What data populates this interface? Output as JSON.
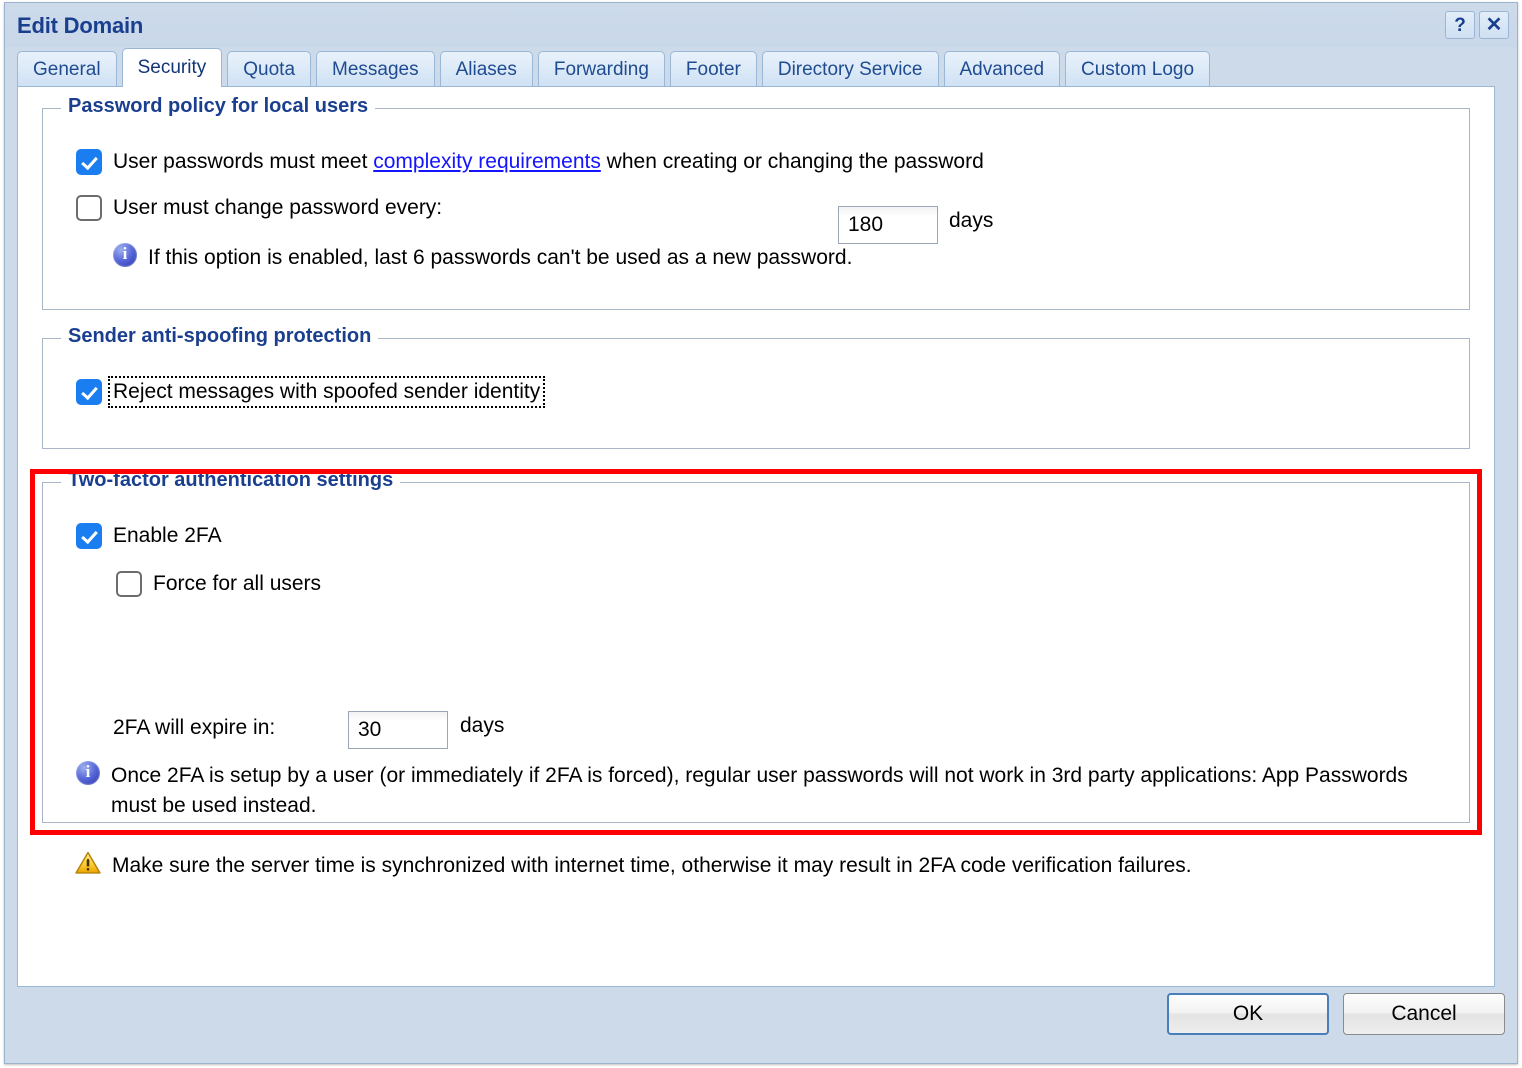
{
  "window": {
    "title": "Edit Domain",
    "help_icon": "?",
    "close_icon": "✕"
  },
  "tabs": [
    {
      "label": "General",
      "active": false
    },
    {
      "label": "Security",
      "active": true
    },
    {
      "label": "Quota",
      "active": false
    },
    {
      "label": "Messages",
      "active": false
    },
    {
      "label": "Aliases",
      "active": false
    },
    {
      "label": "Forwarding",
      "active": false
    },
    {
      "label": "Footer",
      "active": false
    },
    {
      "label": "Directory Service",
      "active": false
    },
    {
      "label": "Advanced",
      "active": false
    },
    {
      "label": "Custom Logo",
      "active": false
    }
  ],
  "password_policy": {
    "legend": "Password policy for local users",
    "complexity_pre": "User passwords must meet ",
    "complexity_link": "complexity requirements",
    "complexity_post": " when creating or changing the password",
    "complexity_checked": true,
    "change_label": "User must change password every:",
    "change_checked": false,
    "days_value": "180",
    "days_unit": "days",
    "note": "If this option is enabled, last 6 passwords can't be used as a new password."
  },
  "anti_spoofing": {
    "legend": "Sender anti-spoofing protection",
    "reject_label": "Reject messages with spoofed sender identity",
    "reject_checked": true
  },
  "two_factor": {
    "legend": "Two-factor authentication settings",
    "enable_label": "Enable 2FA",
    "enable_checked": true,
    "force_label": "Force for all users",
    "force_checked": false,
    "expire_label": "2FA will expire in:",
    "expire_value": "30",
    "expire_unit": "days",
    "info_note": "Once 2FA is setup by a user (or immediately if 2FA is forced), regular user passwords will not work in 3rd party applications: App Passwords must be used instead.",
    "warning_note": "Make sure the server time is synchronized with internet time, otherwise it may result in 2FA code verification failures."
  },
  "footer_buttons": {
    "ok": "OK",
    "cancel": "Cancel"
  },
  "colors": {
    "highlight_box": "#ff0000",
    "accent_blue": "#1a7ef0",
    "legend_navy": "#1b3f8f",
    "link_blue": "#1414ff",
    "dialog_bg": "#ccdaea"
  }
}
